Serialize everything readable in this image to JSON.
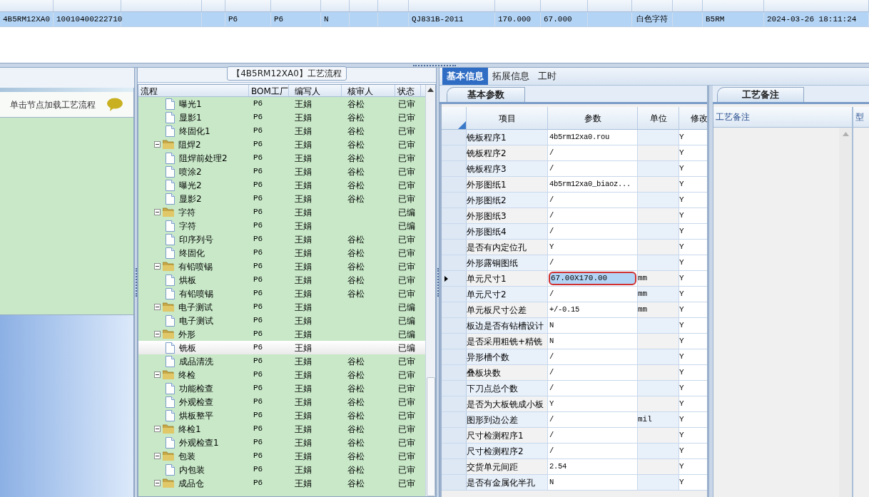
{
  "top_grid": {
    "rows": [
      {
        "selected": true,
        "cells": [
          "4B5RM12XA0",
          "10010400222710",
          "",
          "",
          "P6",
          "P6",
          "N",
          "",
          "",
          "QJ831B-2011",
          "170.000",
          "67.000",
          "",
          "白色字符",
          "",
          "B5RM",
          "2024-03-26 18:11:24"
        ]
      }
    ]
  },
  "left_panel": {
    "hint": "单击节点加载工艺流程"
  },
  "flow_panel": {
    "title": "【4B5RM12XA0】工艺流程",
    "columns": [
      "流程",
      "BOM工厂",
      "编写人",
      "核审人",
      "状态"
    ],
    "items": [
      {
        "kind": "step",
        "name": "曝光1",
        "factory": "P6",
        "author": "王娟",
        "reviewer": "谷松",
        "status": "已审",
        "selected": false
      },
      {
        "kind": "step",
        "name": "显影1",
        "factory": "P6",
        "author": "王娟",
        "reviewer": "谷松",
        "status": "已审",
        "selected": false
      },
      {
        "kind": "step",
        "name": "终固化1",
        "factory": "P6",
        "author": "王娟",
        "reviewer": "谷松",
        "status": "已审",
        "selected": false
      },
      {
        "kind": "folder",
        "name": "阻焊2",
        "factory": "P6",
        "author": "王娟",
        "reviewer": "谷松",
        "status": "已审",
        "selected": false,
        "expanded": true,
        "children": [
          {
            "kind": "step",
            "name": "阻焊前处理2",
            "factory": "P6",
            "author": "王娟",
            "reviewer": "谷松",
            "status": "已审",
            "selected": false
          },
          {
            "kind": "step",
            "name": "喷涂2",
            "factory": "P6",
            "author": "王娟",
            "reviewer": "谷松",
            "status": "已审",
            "selected": false
          },
          {
            "kind": "step",
            "name": "曝光2",
            "factory": "P6",
            "author": "王娟",
            "reviewer": "谷松",
            "status": "已审",
            "selected": false
          },
          {
            "kind": "step",
            "name": "显影2",
            "factory": "P6",
            "author": "王娟",
            "reviewer": "谷松",
            "status": "已审",
            "selected": false
          }
        ]
      },
      {
        "kind": "folder",
        "name": "字符",
        "factory": "P6",
        "author": "王娟",
        "status": "已编",
        "selected": false,
        "expanded": true,
        "children": [
          {
            "kind": "step",
            "name": "字符",
            "factory": "P6",
            "author": "王娟",
            "status": "已编",
            "selected": false
          },
          {
            "kind": "step",
            "name": "印序列号",
            "factory": "P6",
            "author": "王娟",
            "reviewer": "谷松",
            "status": "已审",
            "selected": false
          },
          {
            "kind": "step",
            "name": "终固化",
            "factory": "P6",
            "author": "王娟",
            "reviewer": "谷松",
            "status": "已审",
            "selected": false
          }
        ]
      },
      {
        "kind": "folder",
        "name": "有铅喷锡",
        "factory": "P6",
        "author": "王娟",
        "reviewer": "谷松",
        "status": "已审",
        "selected": false,
        "expanded": true,
        "children": [
          {
            "kind": "step",
            "name": "烘板",
            "factory": "P6",
            "author": "王娟",
            "reviewer": "谷松",
            "status": "已审",
            "selected": false
          },
          {
            "kind": "step",
            "name": "有铅喷锡",
            "factory": "P6",
            "author": "王娟",
            "reviewer": "谷松",
            "status": "已审",
            "selected": false
          }
        ]
      },
      {
        "kind": "folder",
        "name": "电子测试",
        "factory": "P6",
        "author": "王娟",
        "status": "已编",
        "selected": false,
        "expanded": true,
        "children": [
          {
            "kind": "step",
            "name": "电子测试",
            "factory": "P6",
            "author": "王娟",
            "status": "已编",
            "selected": false
          }
        ]
      },
      {
        "kind": "folder",
        "name": "外形",
        "factory": "P6",
        "author": "王娟",
        "status": "已编",
        "selected": false,
        "expanded": true,
        "children": [
          {
            "kind": "step",
            "name": "铣板",
            "factory": "P6",
            "author": "王娟",
            "status": "已编",
            "selected": true
          },
          {
            "kind": "step",
            "name": "成品清洗",
            "factory": "P6",
            "author": "王娟",
            "reviewer": "谷松",
            "status": "已审",
            "selected": false
          }
        ]
      },
      {
        "kind": "folder",
        "name": "终检",
        "factory": "P6",
        "author": "王娟",
        "reviewer": "谷松",
        "status": "已审",
        "selected": false,
        "expanded": true,
        "children": [
          {
            "kind": "step",
            "name": "功能检查",
            "factory": "P6",
            "author": "王娟",
            "reviewer": "谷松",
            "status": "已审",
            "selected": false
          },
          {
            "kind": "step",
            "name": "外观检查",
            "factory": "P6",
            "author": "王娟",
            "reviewer": "谷松",
            "status": "已审",
            "selected": false
          },
          {
            "kind": "step",
            "name": "烘板整平",
            "factory": "P6",
            "author": "王娟",
            "reviewer": "谷松",
            "status": "已审",
            "selected": false
          }
        ]
      },
      {
        "kind": "folder",
        "name": "终检1",
        "factory": "P6",
        "author": "王娟",
        "reviewer": "谷松",
        "status": "已审",
        "selected": false,
        "expanded": true,
        "children": [
          {
            "kind": "step",
            "name": "外观检查1",
            "factory": "P6",
            "author": "王娟",
            "reviewer": "谷松",
            "status": "已审",
            "selected": false
          }
        ]
      },
      {
        "kind": "folder",
        "name": "包装",
        "factory": "P6",
        "author": "王娟",
        "reviewer": "谷松",
        "status": "已审",
        "selected": false,
        "expanded": true,
        "children": [
          {
            "kind": "step",
            "name": "内包装",
            "factory": "P6",
            "author": "王娟",
            "reviewer": "谷松",
            "status": "已审",
            "selected": false
          }
        ]
      },
      {
        "kind": "folder",
        "name": "成品仓",
        "factory": "P6",
        "author": "王娟",
        "reviewer": "谷松",
        "status": "已审",
        "selected": false,
        "expanded": true
      }
    ]
  },
  "tabs": [
    {
      "label": "基本信息",
      "selected": true
    },
    {
      "label": "拓展信息",
      "selected": false
    },
    {
      "label": "工时",
      "selected": false
    }
  ],
  "params_panel": {
    "tab": "基本参数",
    "columns": [
      "项目",
      "参数",
      "单位",
      "修改"
    ],
    "rows": [
      {
        "item": "铣板程序1",
        "value": "4b5rm12xa0.rou",
        "modified": "Y",
        "selected": false
      },
      {
        "item": "铣板程序2",
        "value": "/",
        "modified": "Y",
        "selected": false
      },
      {
        "item": "铣板程序3",
        "value": "/",
        "modified": "Y",
        "selected": false
      },
      {
        "item": "外形图纸1",
        "value": "4b5rm12xa0_biaoz...",
        "modified": "Y",
        "selected": false
      },
      {
        "item": "外形图纸2",
        "value": "/",
        "modified": "Y",
        "selected": false
      },
      {
        "item": "外形图纸3",
        "value": "/",
        "modified": "Y",
        "selected": false
      },
      {
        "item": "外形图纸4",
        "value": "/",
        "modified": "Y",
        "selected": false
      },
      {
        "item": "是否有内定位孔",
        "value": "Y",
        "modified": "Y",
        "selected": false
      },
      {
        "item": "外形露铜图纸",
        "value": "/",
        "modified": "Y",
        "selected": false
      },
      {
        "item": "单元尺寸1",
        "value": "67.00X170.00",
        "unit": "mm",
        "modified": "Y",
        "selected": true
      },
      {
        "item": "单元尺寸2",
        "value": "/",
        "unit": "mm",
        "modified": "Y",
        "selected": false
      },
      {
        "item": "单元板尺寸公差",
        "value": "+/-0.15",
        "unit": "mm",
        "modified": "Y",
        "selected": false
      },
      {
        "item": "板边是否有钻槽设计",
        "value": "N",
        "modified": "Y",
        "selected": false
      },
      {
        "item": "是否采用粗铣+精铣",
        "value": "N",
        "modified": "Y",
        "selected": false
      },
      {
        "item": "异形槽个数",
        "value": "/",
        "modified": "Y",
        "selected": false
      },
      {
        "item": "叠板块数",
        "value": "/",
        "modified": "Y",
        "selected": false
      },
      {
        "item": "下刀点总个数",
        "value": "/",
        "modified": "Y",
        "selected": false
      },
      {
        "item": "是否为大板铣成小板",
        "value": "Y",
        "modified": "Y",
        "selected": false
      },
      {
        "item": "图形到边公差",
        "value": "/",
        "unit": "mil",
        "modified": "Y",
        "selected": false
      },
      {
        "item": "尺寸检测程序1",
        "value": "/",
        "modified": "Y",
        "selected": false
      },
      {
        "item": "尺寸检测程序2",
        "value": "/",
        "modified": "Y",
        "selected": false
      },
      {
        "item": "交货单元间距",
        "value": "2.54",
        "modified": "Y",
        "selected": false
      },
      {
        "item": "是否有金属化半孔",
        "value": "N",
        "modified": "Y",
        "selected": false
      }
    ]
  },
  "notes_panel": {
    "tab": "工艺备注",
    "columns": [
      "工艺备注",
      "型"
    ]
  }
}
